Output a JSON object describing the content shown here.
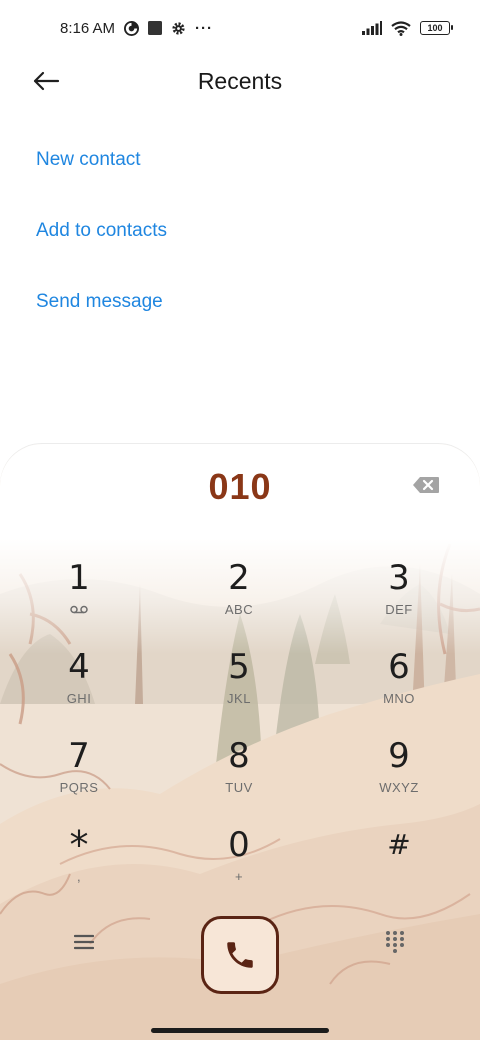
{
  "status_bar": {
    "time": "8:16 AM",
    "icons_left": [
      "data-saver-icon",
      "notification-square-icon",
      "settings-gear-icon",
      "more-dots-icon"
    ],
    "more_dots": "···",
    "icons_right": [
      "signal-icon",
      "wifi-icon",
      "battery-icon"
    ],
    "battery_level": "100"
  },
  "header": {
    "title": "Recents",
    "back_icon": "back-arrow-icon"
  },
  "actions": {
    "new_contact": "New contact",
    "add_to_contacts": "Add to contacts",
    "send_message": "Send message"
  },
  "dialer": {
    "number": "010",
    "backspace_icon": "backspace-icon",
    "keys": [
      {
        "digit": "1",
        "letters": "",
        "sub_icon": "voicemail-icon"
      },
      {
        "digit": "2",
        "letters": "ABC"
      },
      {
        "digit": "3",
        "letters": "DEF"
      },
      {
        "digit": "4",
        "letters": "GHI"
      },
      {
        "digit": "5",
        "letters": "JKL"
      },
      {
        "digit": "6",
        "letters": "MNO"
      },
      {
        "digit": "7",
        "letters": "PQRS"
      },
      {
        "digit": "8",
        "letters": "TUV"
      },
      {
        "digit": "9",
        "letters": "WXYZ"
      },
      {
        "digit": "*",
        "letters": ","
      },
      {
        "digit": "0",
        "letters": "+"
      },
      {
        "digit": "#",
        "letters": ""
      }
    ],
    "bottom": {
      "menu_icon": "menu-icon",
      "call_icon": "phone-icon",
      "keypad_icon": "dialpad-icon"
    }
  },
  "colors": {
    "accent": "#1f86e0",
    "number": "#8a3717",
    "call_button_bg": "#f7e6d7",
    "call_button_border": "#5a2414"
  }
}
